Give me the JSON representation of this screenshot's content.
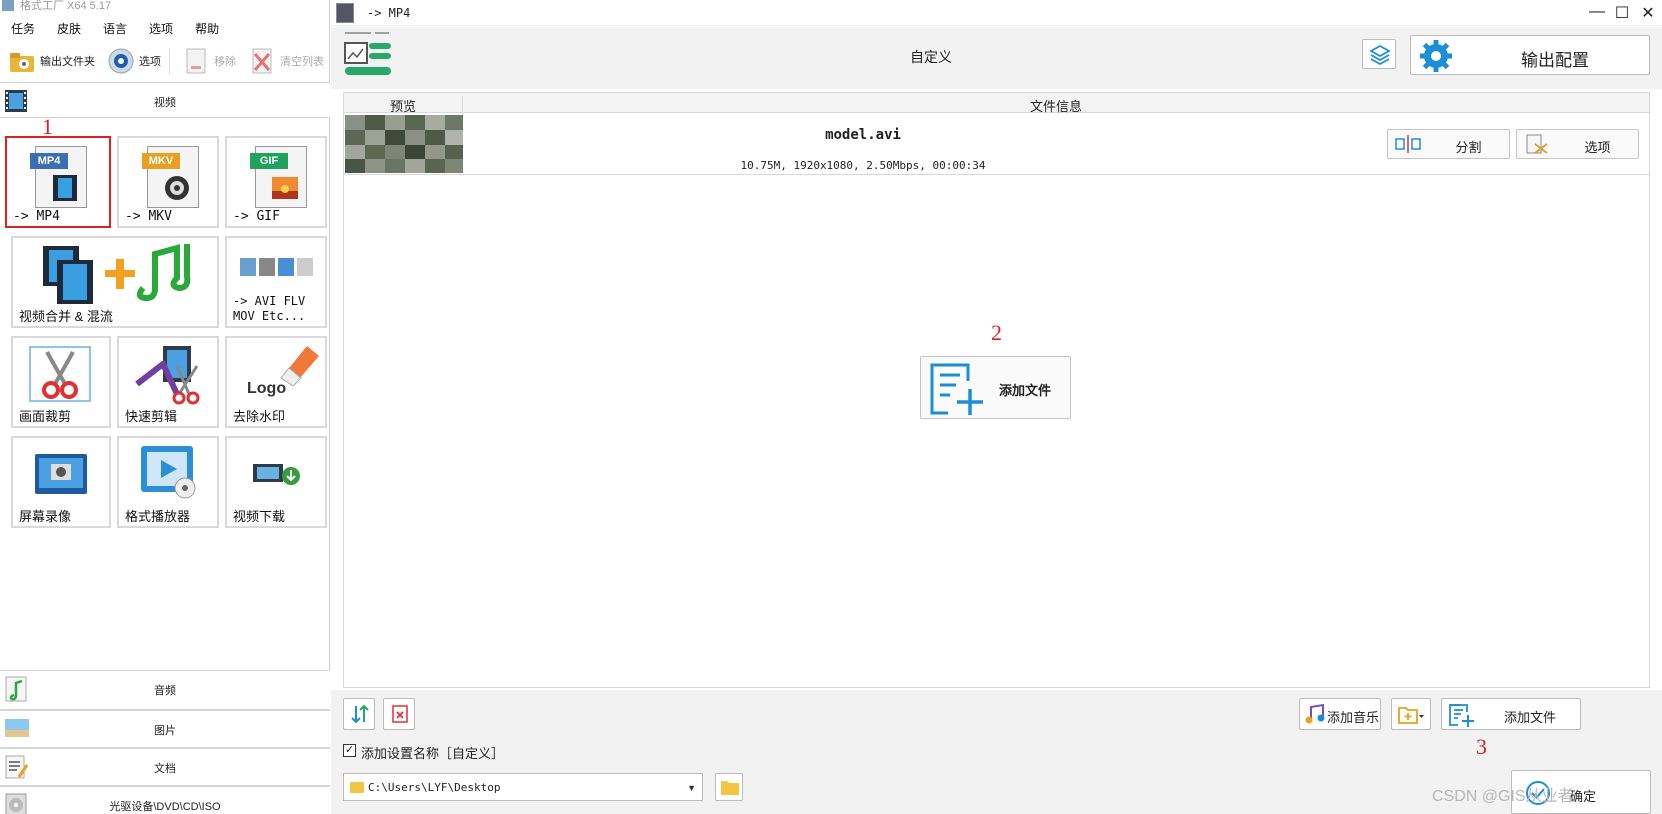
{
  "app": {
    "title": "格式工厂 X64 5.17"
  },
  "menu": [
    "任务",
    "皮肤",
    "语言",
    "选项",
    "帮助"
  ],
  "toolbar": {
    "output_folder": "输出文件夹",
    "options": "选项",
    "remove": "移除",
    "clear_list": "清空列表"
  },
  "categories": {
    "video": "视频",
    "audio": "音频",
    "picture": "图片",
    "document": "文档",
    "disc": "光驱设备\\DVD\\CD\\ISO"
  },
  "tiles": {
    "mp4": {
      "label": "-> MP4",
      "tag": "MP4"
    },
    "mkv": {
      "label": "-> MKV",
      "tag": "MKV"
    },
    "gif": {
      "label": "-> GIF",
      "tag": "GIF"
    },
    "merge": {
      "label": "视频合并 & 混流"
    },
    "avi": {
      "label": "-> AVI FLV\nMOV Etc..."
    },
    "crop": {
      "label": "画面裁剪"
    },
    "quick_cut": {
      "label": "快速剪辑"
    },
    "watermark": {
      "label": "去除水印",
      "logo_text": "Logo"
    },
    "record": {
      "label": "屏幕录像"
    },
    "player": {
      "label": "格式播放器"
    },
    "download": {
      "label": "视频下载"
    }
  },
  "annotations": {
    "n1": "1",
    "n2": "2",
    "n3": "3"
  },
  "window": {
    "title": "-> MP4",
    "minimize": "—",
    "maximize": "☐",
    "close": "✕"
  },
  "header": {
    "center_title": "自定义",
    "output_config": "输出配置"
  },
  "file_table": {
    "col_preview": "预览",
    "col_info": "文件信息",
    "rows": [
      {
        "name": "model.avi",
        "info": "10.75M, 1920x1080, 2.50Mbps, 00:00:34",
        "split_label": "分割",
        "options_label": "选项"
      }
    ]
  },
  "center_add_file": "添加文件",
  "bottom": {
    "add_music": "添加音乐",
    "add_file": "添加文件",
    "add_setting_name": "添加设置名称［自定义］",
    "checkbox_checked": "✓",
    "output_path": "C:\\Users\\LYF\\Desktop",
    "ok": "确定"
  },
  "watermark": "CSDN @GIS从业者",
  "colors": {
    "accent_blue": "#1a8fd6",
    "green": "#2aa86a",
    "red": "#e02020",
    "mp4_tag": "#3b6fb5",
    "mkv_tag": "#e8a020",
    "gif_tag": "#1fa35c"
  }
}
